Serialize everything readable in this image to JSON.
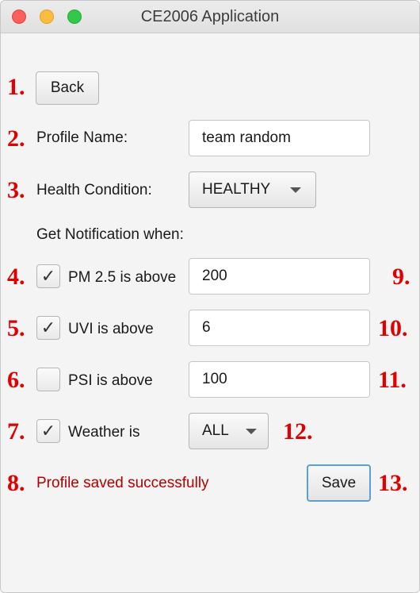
{
  "window": {
    "title": "CE2006 Application"
  },
  "numbers": [
    "1.",
    "2.",
    "3.",
    "4.",
    "5.",
    "6.",
    "7.",
    "8.",
    "9.",
    "10.",
    "11.",
    "12.",
    "13."
  ],
  "back_button": {
    "label": "Back"
  },
  "profile": {
    "label": "Profile Name:",
    "value": "team random"
  },
  "health": {
    "label": "Health Condition:",
    "selected": "HEALTHY"
  },
  "notify_heading": "Get Notification when:",
  "pm25": {
    "label": "PM 2.5 is above",
    "checked": true,
    "value": "200"
  },
  "uvi": {
    "label": "UVI is above",
    "checked": true,
    "value": "6"
  },
  "psi": {
    "label": "PSI is above",
    "checked": false,
    "value": "100"
  },
  "weather": {
    "label": "Weather is",
    "checked": true,
    "selected": "ALL"
  },
  "status_message": "Profile saved successfully",
  "save_button": {
    "label": "Save"
  },
  "colors": {
    "annotation": "#e00000",
    "status": "#b30000",
    "focus": "#5aa0d8"
  },
  "icons": {
    "checkmark": "✓"
  }
}
